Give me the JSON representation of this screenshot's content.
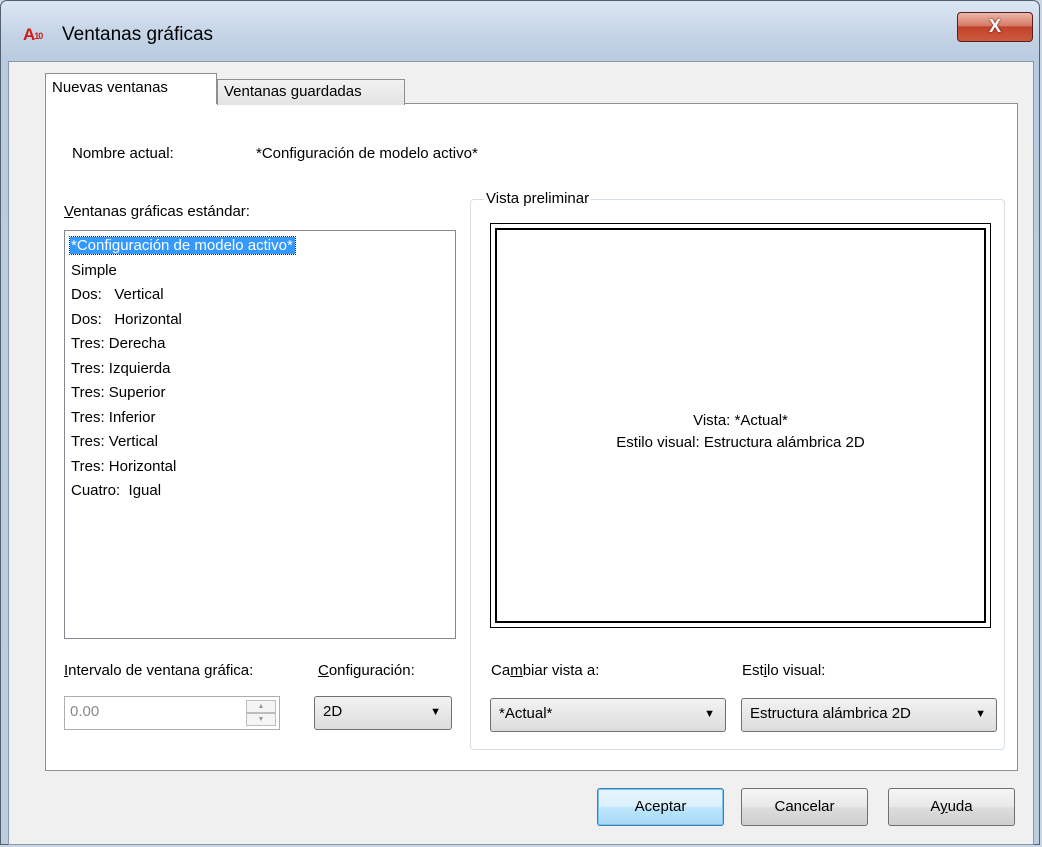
{
  "window": {
    "title": "Ventanas gráficas",
    "icon_text": "A",
    "icon_sub": "10",
    "close_symbol": "X"
  },
  "tabs": [
    {
      "label": "Nuevas ventanas",
      "active": true
    },
    {
      "label": "Ventanas guardadas",
      "active": false
    }
  ],
  "current_name": {
    "label": "Nombre actual:",
    "value": "*Configuración de modelo activo*"
  },
  "standard_viewports": {
    "label_first": "V",
    "label_rest": "entanas gráficas estándar:",
    "items": [
      "*Configuración de modelo activo*",
      "Simple",
      "Dos:   Vertical",
      "Dos:   Horizontal",
      "Tres: Derecha",
      "Tres: Izquierda",
      "Tres: Superior",
      "Tres: Inferior",
      "Tres: Vertical",
      "Tres: Horizontal",
      "Cuatro:  Igual"
    ],
    "selected": "*Configuración de modelo activo*"
  },
  "preview": {
    "legend": "Vista preliminar",
    "line1": "Vista: *Actual*",
    "line2": "Estilo visual: Estructura alámbrica 2D"
  },
  "spacing": {
    "label_first": "I",
    "label_rest": "ntervalo de ventana gráfica:",
    "value": "0.00",
    "up_arrow": "▲",
    "down_arrow": "▼"
  },
  "setup": {
    "label_first": "C",
    "label_rest": "onfiguración:",
    "value": "2D"
  },
  "change_view": {
    "label_pre": "Ca",
    "label_key": "m",
    "label_post": "biar vista a:",
    "value": "*Actual*"
  },
  "visual_style": {
    "label_pre": "Est",
    "label_key": "i",
    "label_post": "lo visual:",
    "value": "Estructura alámbrica 2D"
  },
  "dropdown_arrow": "▼",
  "buttons": {
    "ok": "Aceptar",
    "cancel": "Cancelar",
    "help_pre": "A",
    "help_key": "y",
    "help_post": "uda"
  }
}
